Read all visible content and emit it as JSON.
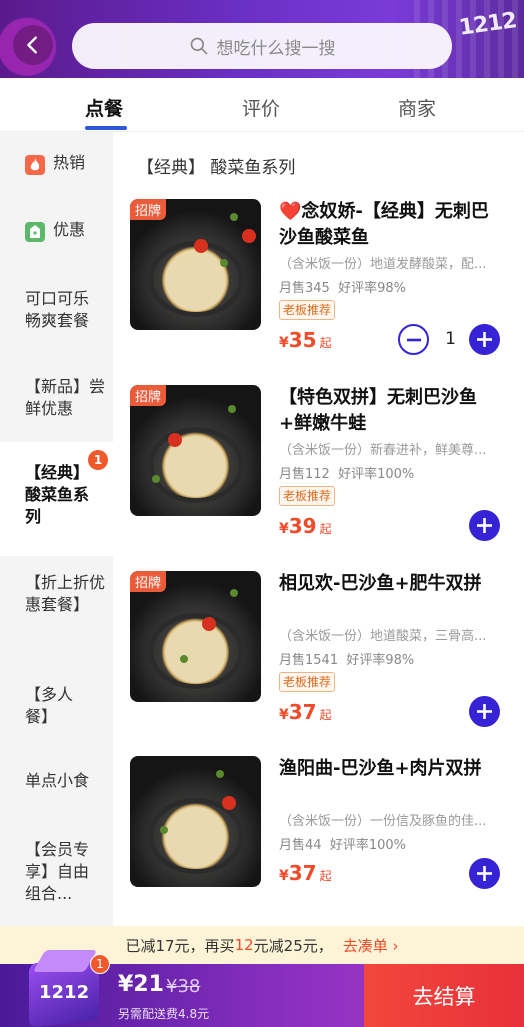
{
  "header": {
    "search_placeholder": "想吃什么搜一搜",
    "badge_text": "1212"
  },
  "tabs": [
    {
      "label": "点餐",
      "active": true
    },
    {
      "label": "评价",
      "active": false
    },
    {
      "label": "商家",
      "active": false
    }
  ],
  "sidebar": {
    "items": [
      {
        "label": "热销",
        "icon": "flame-icon"
      },
      {
        "label": "优惠",
        "icon": "discount-tag-icon"
      },
      {
        "label": "可口可乐畅爽套餐"
      },
      {
        "label": "【新品】尝鲜优惠"
      },
      {
        "label": "【经典】酸菜鱼系列",
        "active": true,
        "badge": "1"
      },
      {
        "label": "【折上折优惠套餐】"
      },
      {
        "label": "【多人餐】"
      },
      {
        "label": "单点小食"
      },
      {
        "label": "【会员专享】自由组合..."
      }
    ]
  },
  "section": {
    "title": "【经典】 酸菜鱼系列"
  },
  "products": [
    {
      "tag_corner": "招牌",
      "name": "❤️念奴娇-【经典】无刺巴沙鱼酸菜鱼",
      "desc": "（含米饭一份）地道发酵酸菜，配...",
      "sales": "月售345",
      "rating": "好评率98%",
      "badge": "老板推荐",
      "price_symbol": "¥",
      "price": "35",
      "price_suffix": "起",
      "quantity": "1"
    },
    {
      "tag_corner": "招牌",
      "name": "【特色双拼】无刺巴沙鱼+鲜嫩牛蛙",
      "desc": "（含米饭一份）新春进补，鲜美尊...",
      "sales": "月售112",
      "rating": "好评率100%",
      "badge": "老板推荐",
      "price_symbol": "¥",
      "price": "39",
      "price_suffix": "起"
    },
    {
      "tag_corner": "招牌",
      "name": "相见欢-巴沙鱼+肥牛双拼",
      "desc": "（含米饭一份）地道酸菜，三骨高...",
      "sales": "月售1541",
      "rating": "好评率98%",
      "badge": "老板推荐",
      "price_symbol": "¥",
      "price": "37",
      "price_suffix": "起"
    },
    {
      "name": "渔阳曲-巴沙鱼+肉片双拼",
      "desc": "（含米饭一份）一份信及豚鱼的佳...",
      "sales": "月售44",
      "rating": "好评率100%",
      "price_symbol": "¥",
      "price": "37",
      "price_suffix": "起"
    }
  ],
  "promo": {
    "part1": "已减17元，再买",
    "highlight": "12",
    "part2": "元减25元，",
    "link": "去凑单 ›"
  },
  "cart": {
    "badge": "1",
    "total": "¥21",
    "original": "¥38",
    "delivery": "另需配送费4.8元",
    "checkout": "去结算",
    "box_label": "1212"
  },
  "colors": {
    "accent": "#3623d6",
    "price": "#f04b2b",
    "checkout": "#e8303a"
  }
}
